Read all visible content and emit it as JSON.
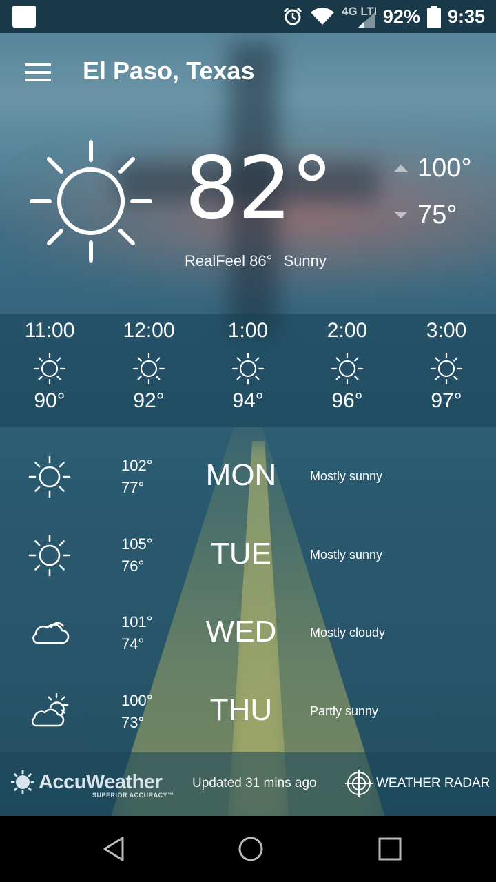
{
  "status_bar": {
    "battery": "92%",
    "time": "9:35",
    "network": "4G LTE",
    "icons": [
      "app-notification-icon",
      "alarm-icon",
      "wifi-icon",
      "4g-lte-icon",
      "signal-icon",
      "battery-icon"
    ]
  },
  "header": {
    "location": "El Paso, Texas",
    "menu_icon": "menu-icon"
  },
  "current": {
    "temperature": "82°",
    "high": "100°",
    "low": "75°",
    "realfeel": "RealFeel 86°",
    "condition": "Sunny",
    "icon": "sun-icon"
  },
  "hourly": [
    {
      "time": "11:00",
      "icon": "sun-icon",
      "temp": "90°"
    },
    {
      "time": "12:00",
      "icon": "sun-icon",
      "temp": "92°"
    },
    {
      "time": "1:00",
      "icon": "sun-icon",
      "temp": "94°"
    },
    {
      "time": "2:00",
      "icon": "sun-icon",
      "temp": "96°"
    },
    {
      "time": "3:00",
      "icon": "sun-icon",
      "temp": "97°"
    }
  ],
  "daily": [
    {
      "day": "MON",
      "high": "102°",
      "low": "77°",
      "desc": "Mostly sunny",
      "icon": "sun-icon"
    },
    {
      "day": "TUE",
      "high": "105°",
      "low": "76°",
      "desc": "Mostly sunny",
      "icon": "sun-icon"
    },
    {
      "day": "WED",
      "high": "101°",
      "low": "74°",
      "desc": "Mostly cloudy",
      "icon": "cloud-icon"
    },
    {
      "day": "THU",
      "high": "100°",
      "low": "73°",
      "desc": "Partly sunny",
      "icon": "partly-sunny-icon"
    }
  ],
  "footer": {
    "brand": "AccuWeather",
    "tagline": "SUPERIOR ACCURACY™",
    "updated": "Updated 31 mins ago",
    "radar_label": "WEATHER RADAR",
    "radar_icon": "crosshair-icon"
  },
  "nav": {
    "icons": [
      "back-icon",
      "home-icon",
      "recents-icon"
    ]
  },
  "colors": {
    "background_top": "#4f7c93",
    "background_bottom": "#254f63",
    "status_bar": "#0f2d3c",
    "text": "#ffffff"
  }
}
